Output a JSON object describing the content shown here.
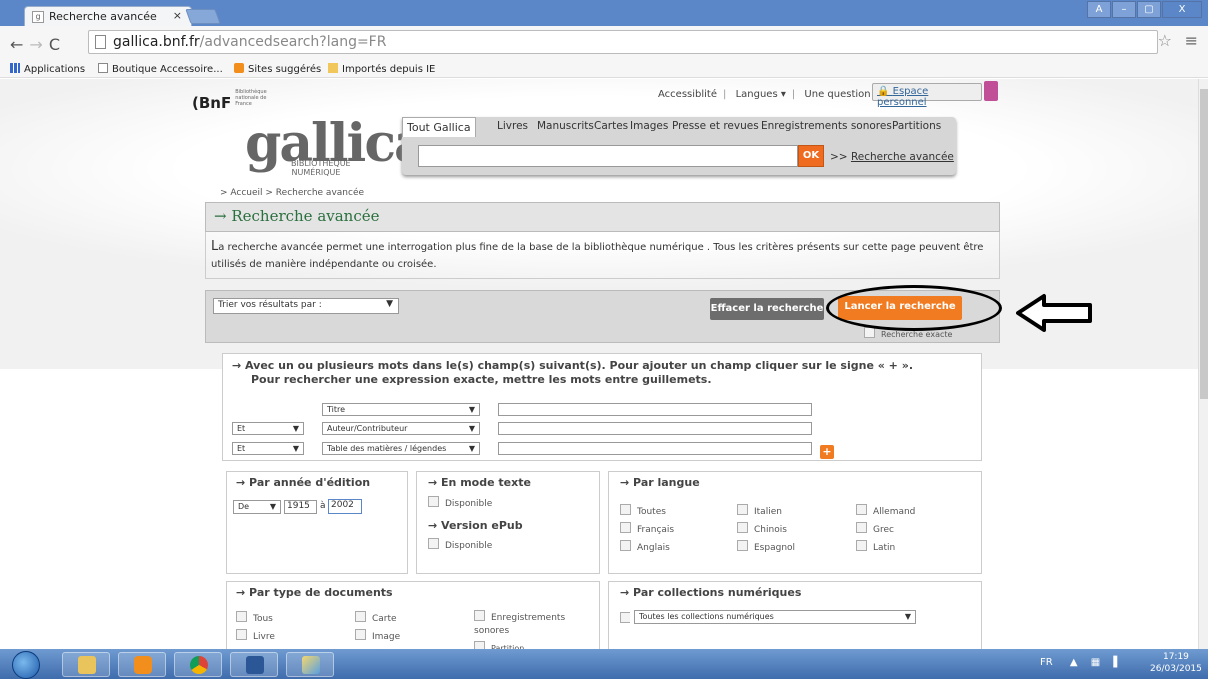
{
  "browser": {
    "tab_title": "Recherche avancée",
    "tab_close": "×",
    "url_host": "gallica.bnf.fr",
    "url_path": "/advancedsearch?lang=FR",
    "window_controls": [
      "A",
      "–",
      "▢",
      "X"
    ]
  },
  "bookmarks": [
    {
      "label": "Applications",
      "icon": "apps-grid-icon"
    },
    {
      "label": "Boutique Accessoire...",
      "icon": "page-icon"
    },
    {
      "label": "Sites suggérés",
      "icon": "suggested-sites-icon"
    },
    {
      "label": "Importés depuis IE",
      "icon": "folder-icon"
    }
  ],
  "header": {
    "bnf_logo": "BnF",
    "bnf_sub": "Bibliothèque nationale de France",
    "links": [
      "Accessiblité",
      "Langues",
      "Une question ?"
    ],
    "espace": "Espace personnel",
    "gallica": "gallica",
    "gallica_sub": "BIBLIOTHÈQUE NUMÉRIQUE"
  },
  "search": {
    "tabs": [
      "Tout Gallica",
      "Livres",
      "Manuscrits",
      "Cartes",
      "Images",
      "Presse et revues",
      "Enregistrements sonores",
      "Partitions"
    ],
    "ok": "OK",
    "adv_prefix": ">>",
    "adv_link": "Recherche avancée"
  },
  "breadcrumb": "> Accueil   > Recherche avancée",
  "advanced": {
    "title": "→ Recherche avancée",
    "intro_first": "L",
    "intro_rest": "a recherche avancée permet une interrogation plus fine de la base de la bibliothèque numérique . Tous les critères présents sur cette page peuvent être utilisés de manière indépendante ou croisée.",
    "sort_label": "Trier vos résultats par :",
    "effacer": "Effacer la recherche",
    "lancer": "Lancer la recherche",
    "exact": "Recherche exacte"
  },
  "criteria": {
    "line1": "→ Avec un ou plusieurs mots dans le(s) champ(s) suivant(s). Pour ajouter un champ cliquer sur le signe « + ».",
    "line2": "Pour rechercher une expression exacte, mettre les mots entre guillemets.",
    "rows": [
      {
        "op": "",
        "field": "Titre"
      },
      {
        "op": "Et",
        "field": "Auteur/Contributeur"
      },
      {
        "op": "Et",
        "field": "Table des matières / légendes"
      }
    ],
    "plus": "+"
  },
  "annee": {
    "title": "→ Par année d'édition",
    "mode": "De",
    "from": "1915",
    "sep": "à",
    "to": "2002"
  },
  "texte": {
    "title": "→ En mode texte",
    "dispo": "Disponible",
    "epub": "→ Version ePub",
    "epub_dispo": "Disponible"
  },
  "langue": {
    "title": "→ Par langue",
    "options": [
      "Toutes",
      "Italien",
      "Allemand",
      "Français",
      "Chinois",
      "Grec",
      "Anglais",
      "Espagnol",
      "Latin"
    ]
  },
  "types": {
    "title": "→ Par type de documents",
    "options": [
      "Tous",
      "Carte",
      "Enregistrements sonores",
      "Livre",
      "Image",
      "Partition"
    ]
  },
  "collections": {
    "title": "→ Par collections numériques",
    "select": "Toutes les collections numériques"
  },
  "taskbar": {
    "lang": "FR",
    "time": "17:19",
    "date": "26/03/2015"
  }
}
